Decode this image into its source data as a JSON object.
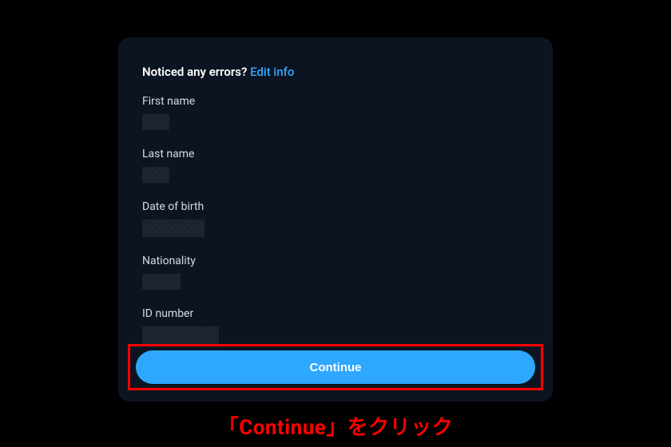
{
  "card": {
    "prompt_text": "Noticed any errors? ",
    "edit_link": "Edit info",
    "fields": {
      "first_name_label": "First name",
      "last_name_label": "Last name",
      "dob_label": "Date of birth",
      "nationality_label": "Nationality",
      "id_number_label": "ID number"
    },
    "continue_label": "Continue"
  },
  "annotation": {
    "caption": "「Continue」をクリック"
  }
}
